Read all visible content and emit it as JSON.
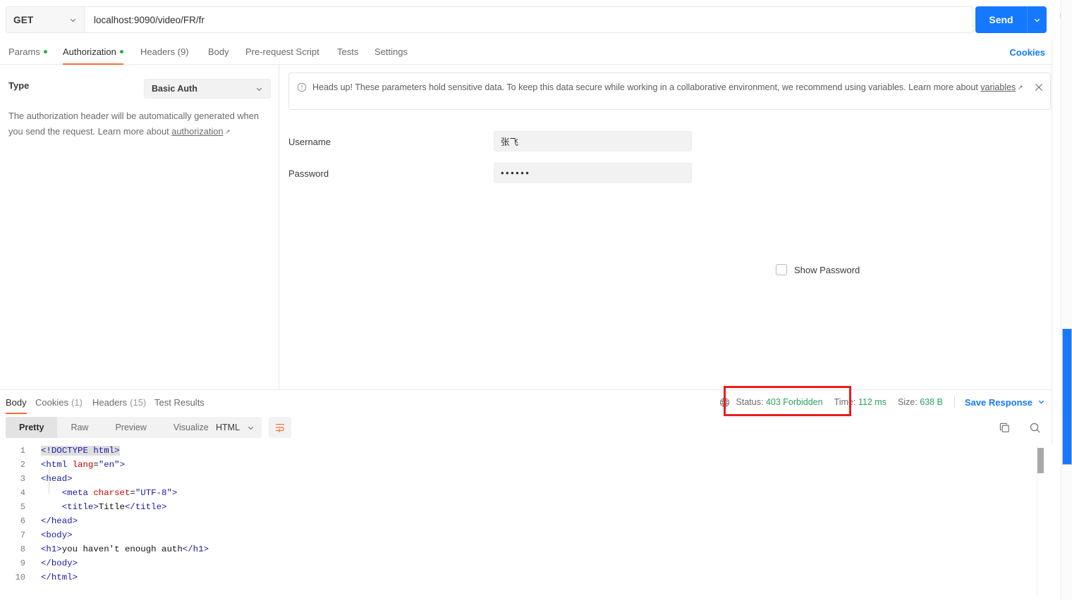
{
  "request": {
    "method": "GET",
    "url": "localhost:9090/video/FR/fr",
    "send_label": "Send",
    "send_caret_icon": "chevron-down-icon",
    "method_caret_icon": "chevron-down-icon",
    "bulb_icon": "lightbulb-icon",
    "tabs": [
      {
        "label": "Params",
        "dot": true,
        "active": false
      },
      {
        "label": "Authorization",
        "dot": true,
        "active": true
      },
      {
        "label": "Headers (9)",
        "dot": false,
        "active": false
      },
      {
        "label": "Body",
        "dot": false,
        "active": false
      },
      {
        "label": "Pre-request Script",
        "dot": false,
        "active": false
      },
      {
        "label": "Tests",
        "dot": false,
        "active": false
      },
      {
        "label": "Settings",
        "dot": false,
        "active": false
      }
    ],
    "cookies_link": "Cookies"
  },
  "auth": {
    "type_label": "Type",
    "type_value": "Basic Auth",
    "help_text": "The authorization header will be automatically generated when you send the request. Learn more about ",
    "help_link": "authorization",
    "banner": {
      "icon": "alert-circle-icon",
      "text": "Heads up! These parameters hold sensitive data. To keep this data secure while working in a collaborative environment, we recommend using variables. Learn more about ",
      "link": "variables",
      "close_icon": "close-icon"
    },
    "username_label": "Username",
    "username_value": "张飞",
    "password_label": "Password",
    "password_value": "••••••",
    "show_password_label": "Show Password",
    "show_password_checked": false
  },
  "response": {
    "tabs": [
      {
        "label": "Body",
        "count": "",
        "active": true
      },
      {
        "label": "Cookies",
        "count": "(1)",
        "active": false
      },
      {
        "label": "Headers",
        "count": "(15)",
        "active": false
      },
      {
        "label": "Test Results",
        "count": "",
        "active": false
      }
    ],
    "globe_icon": "globe-icon",
    "status_label": "Status:",
    "status_value": "403 Forbidden",
    "time_label": "Time:",
    "time_value": "112 ms",
    "size_label": "Size:",
    "size_value": "638 B",
    "save_response_label": "Save Response",
    "save_response_caret_icon": "chevron-down-icon",
    "highlight_color": "#ee1c1c",
    "status_value_color": "#2aa160",
    "view_modes": [
      {
        "label": "Pretty",
        "active": true
      },
      {
        "label": "Raw",
        "active": false
      },
      {
        "label": "Preview",
        "active": false
      },
      {
        "label": "Visualize",
        "active": false
      }
    ],
    "language": "HTML",
    "language_caret_icon": "chevron-down-icon",
    "wrap_icon": "word-wrap-icon",
    "copy_icon": "copy-icon",
    "search_icon": "search-icon"
  },
  "code": {
    "lines": [
      {
        "n": "1",
        "parts": [
          {
            "t": "<!DOCTYPE html>",
            "c": "tg sel"
          }
        ]
      },
      {
        "n": "2",
        "parts": [
          {
            "t": "<html ",
            "c": "tg"
          },
          {
            "t": "lang",
            "c": "at"
          },
          {
            "t": "=",
            "c": "tx"
          },
          {
            "t": "\"en\"",
            "c": "st"
          },
          {
            "t": ">",
            "c": "tg"
          }
        ]
      },
      {
        "n": "3",
        "parts": [
          {
            "t": "<head>",
            "c": "tg"
          }
        ]
      },
      {
        "n": "4",
        "parts": [
          {
            "t": "    <meta ",
            "c": "tg"
          },
          {
            "t": "charset",
            "c": "at"
          },
          {
            "t": "=",
            "c": "tx"
          },
          {
            "t": "\"UTF-8\"",
            "c": "st"
          },
          {
            "t": ">",
            "c": "tg"
          }
        ]
      },
      {
        "n": "5",
        "parts": [
          {
            "t": "    <title>",
            "c": "tg"
          },
          {
            "t": "Title",
            "c": "tx"
          },
          {
            "t": "</title>",
            "c": "tg"
          }
        ]
      },
      {
        "n": "6",
        "parts": [
          {
            "t": "</head>",
            "c": "tg"
          }
        ]
      },
      {
        "n": "7",
        "parts": [
          {
            "t": "<body>",
            "c": "tg"
          }
        ]
      },
      {
        "n": "8",
        "parts": [
          {
            "t": "<h1>",
            "c": "tg"
          },
          {
            "t": "you haven't enough auth",
            "c": "tx"
          },
          {
            "t": "</h1>",
            "c": "tg"
          }
        ]
      },
      {
        "n": "9",
        "parts": [
          {
            "t": "</body>",
            "c": "tg"
          }
        ]
      },
      {
        "n": "10",
        "parts": [
          {
            "t": "</html>",
            "c": "tg"
          }
        ]
      }
    ]
  }
}
